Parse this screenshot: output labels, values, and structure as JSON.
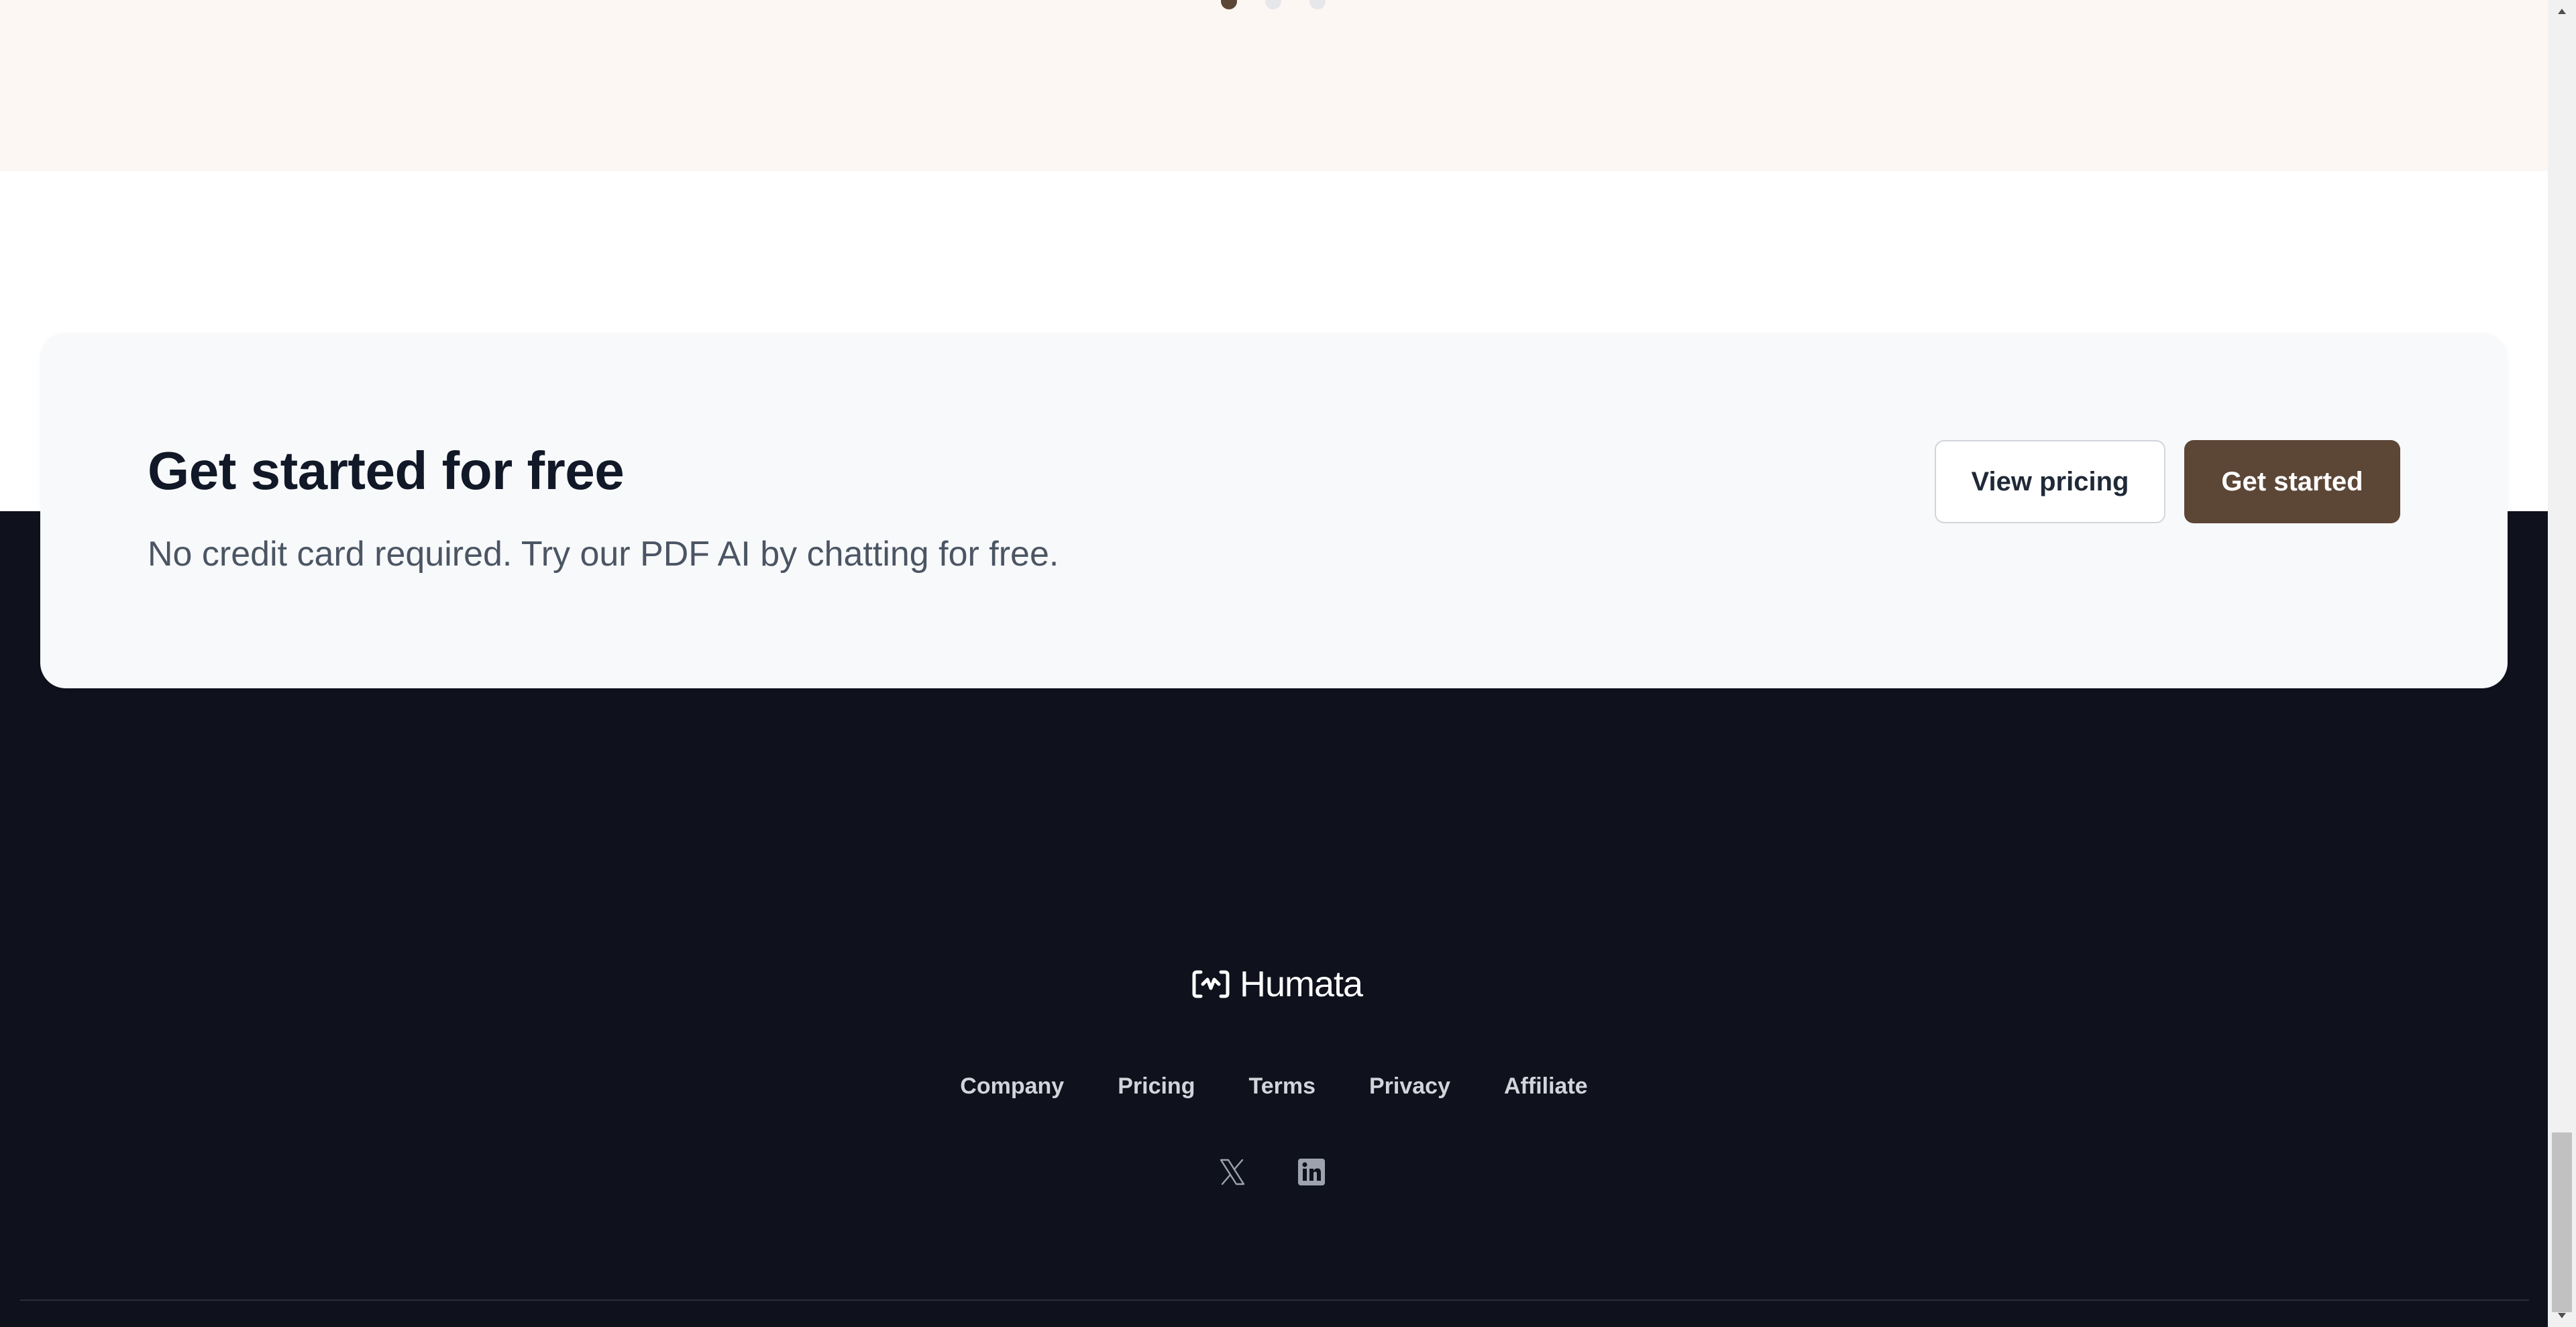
{
  "carousel": {
    "dots": [
      {
        "name": "carousel-dot-1",
        "active": true
      },
      {
        "name": "carousel-dot-2",
        "active": false
      },
      {
        "name": "carousel-dot-3",
        "active": false
      }
    ]
  },
  "cta": {
    "title": "Get started for free",
    "subtitle": "No credit card required. Try our PDF AI by chatting for free.",
    "secondary_button": "View pricing",
    "primary_button": "Get started"
  },
  "footer": {
    "brand_name": "Humata",
    "links": [
      "Company",
      "Pricing",
      "Terms",
      "Privacy",
      "Affiliate"
    ],
    "social": [
      "x-icon",
      "linkedin-icon"
    ]
  },
  "colors": {
    "accent_brown": "#5c4636",
    "footer_bg": "#0f111c",
    "top_band_bg": "#fcf7f3",
    "card_bg": "#f8f9fb"
  }
}
